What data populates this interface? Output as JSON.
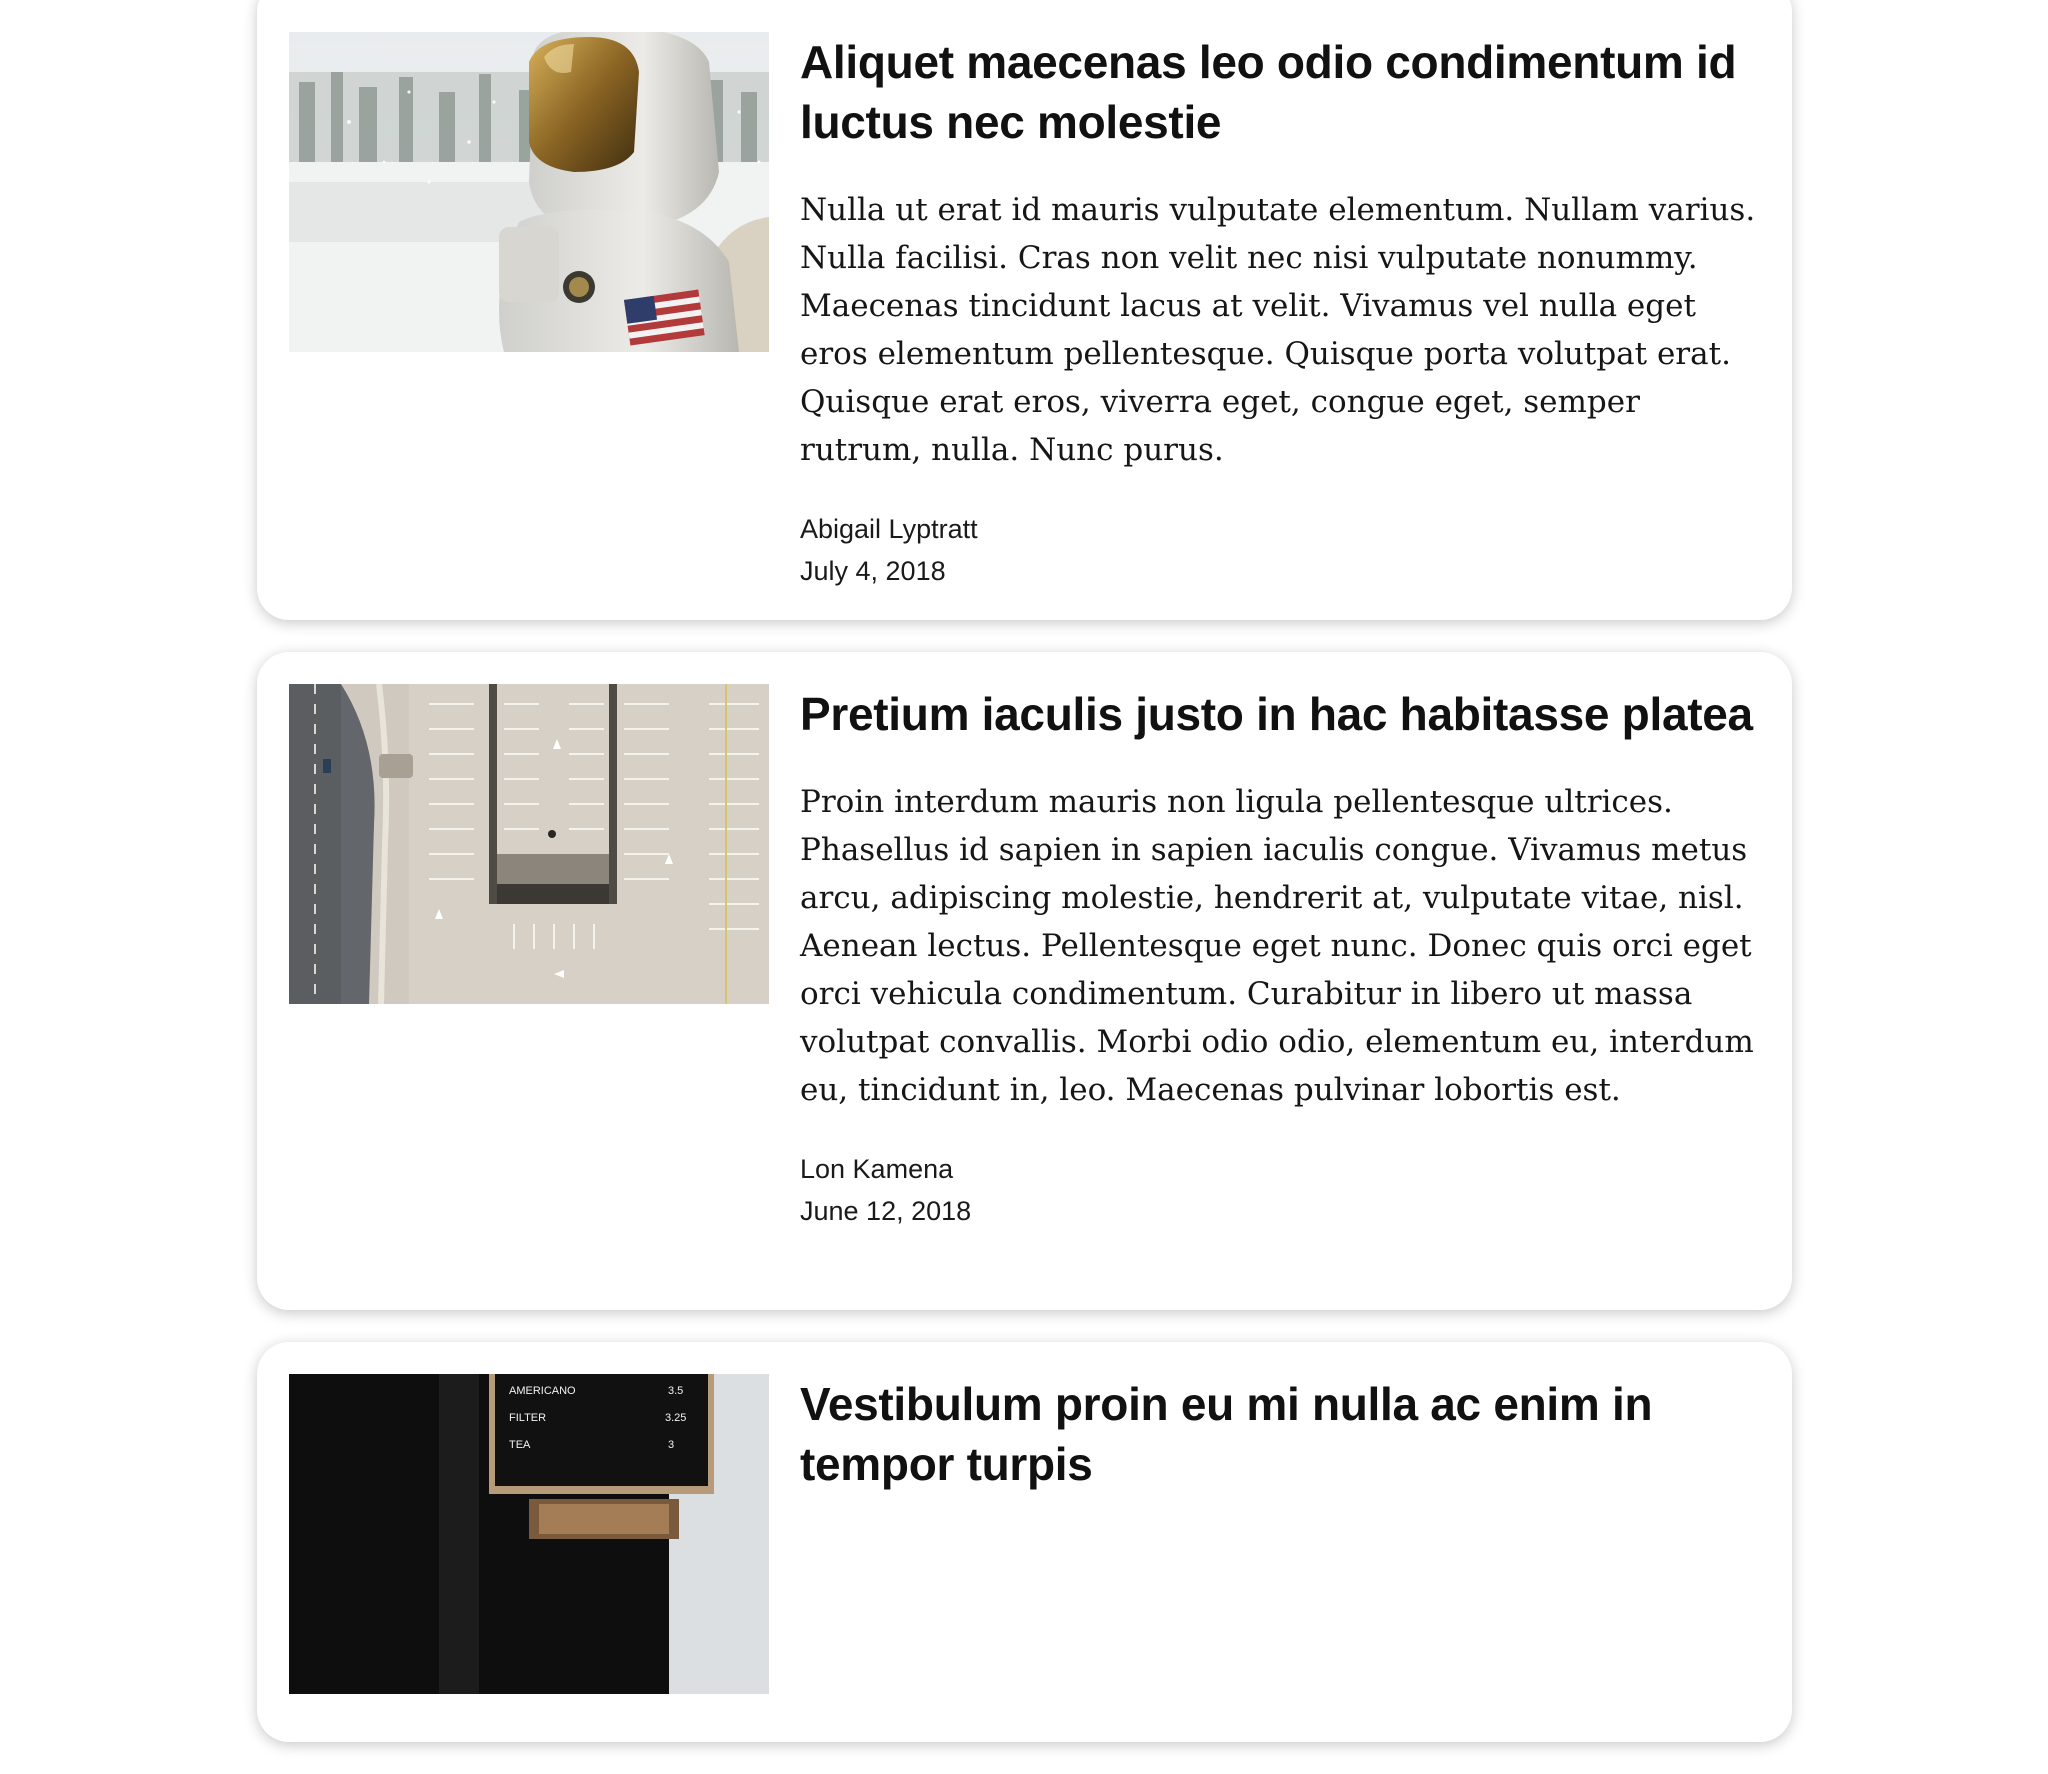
{
  "articles": [
    {
      "title": "Aliquet maecenas leo odio condimentum id luctus nec molestie",
      "excerpt": "Nulla ut erat id mauris vulputate elementum. Nullam varius. Nulla facilisi. Cras non velit nec nisi vulputate nonummy. Maecenas tincidunt lacus at velit. Vivamus vel nulla eget eros elementum pellentesque. Quisque porta volutpat erat. Quisque erat eros, viverra eget, congue eget, semper rutrum, nulla. Nunc purus.",
      "author": "Abigail Lyptratt",
      "date": "July 4, 2018",
      "image": "astronaut-photo"
    },
    {
      "title": "Pretium iaculis justo in hac habitasse platea",
      "excerpt": "Proin interdum mauris non ligula pellentesque ultrices. Phasellus id sapien in sapien iaculis congue. Vivamus metus arcu, adipiscing molestie, hendrerit at, vulputate vitae, nisl. Aenean lectus. Pellentesque eget nunc. Donec quis orci eget orci vehicula condimentum. Curabitur in libero ut massa volutpat convallis. Morbi odio odio, elementum eu, interdum eu, tincidunt in, leo. Maecenas pulvinar lobortis est.",
      "author": "Lon Kamena",
      "date": "June 12, 2018",
      "image": "parking-lot-aerial-photo"
    },
    {
      "title": "Vestibulum proin eu mi nulla ac enim in tempor turpis",
      "excerpt": "",
      "author": "",
      "date": "",
      "image": "coffee-menu-board-photo",
      "menu": [
        {
          "item": "AMERICANO",
          "price": "3.5"
        },
        {
          "item": "FILTER",
          "price": "3.25"
        },
        {
          "item": "TEA",
          "price": "3"
        }
      ]
    }
  ]
}
